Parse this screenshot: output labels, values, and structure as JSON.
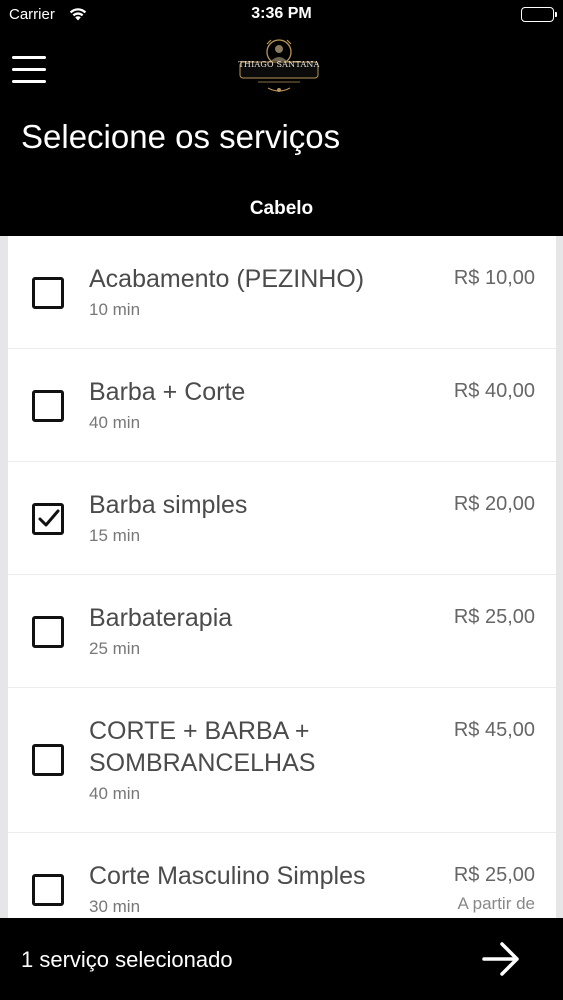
{
  "status_bar": {
    "carrier": "Carrier",
    "time": "3:36 PM",
    "wifi_icon": "wifi-icon",
    "battery_icon": "battery-full-icon"
  },
  "nav": {
    "menu_icon": "hamburger-menu-icon",
    "logo_text": "THIAGO SANTANA"
  },
  "header": {
    "title": "Selecione os serviços",
    "category": "Cabelo"
  },
  "services": [
    {
      "name": "Acabamento (PEZINHO)",
      "duration": "10 min",
      "price": "R$ 10,00",
      "checked": false
    },
    {
      "name": "Barba + Corte",
      "duration": "40 min",
      "price": "R$ 40,00",
      "checked": false
    },
    {
      "name": "Barba simples",
      "duration": "15 min",
      "price": "R$ 20,00",
      "checked": true
    },
    {
      "name": "Barbaterapia",
      "duration": "25 min",
      "price": "R$ 25,00",
      "checked": false
    },
    {
      "name": "CORTE + BARBA + SOMBRANCELHAS",
      "name_line1": "CORTE + BARBA +",
      "name_line2": "SOMBRANCELHAS",
      "duration": "40 min",
      "price": "R$ 45,00",
      "checked": false
    },
    {
      "name": "Corte Masculino Simples",
      "duration": "30 min",
      "price": "R$ 25,00",
      "price_note": "A partir de",
      "checked": false
    }
  ],
  "footer": {
    "selection_text": "1 serviço selecionado",
    "next_icon": "arrow-right-icon"
  },
  "colors": {
    "background": "#000000",
    "list_bg": "#ffffff",
    "text_primary": "#4b4b4b",
    "accent": "#ffffff"
  }
}
